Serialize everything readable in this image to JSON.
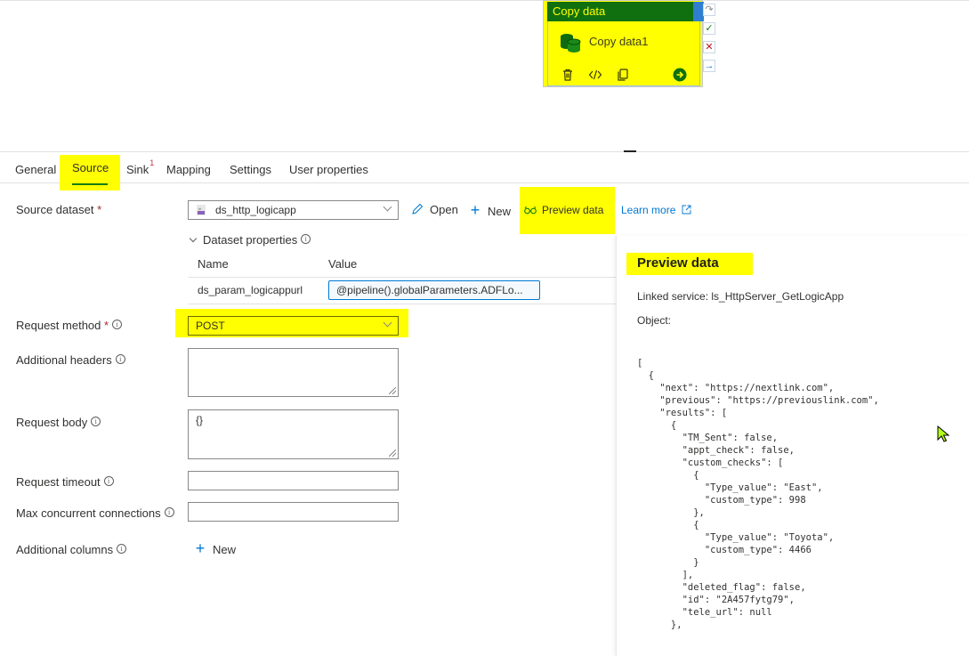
{
  "canvas": {
    "activity": {
      "type_label": "Copy data",
      "name": "Copy data1",
      "tools": [
        "delete-icon",
        "code-icon",
        "clone-icon",
        "go-icon"
      ],
      "side_actions": [
        "redo-icon",
        "success-icon",
        "failure-icon",
        "completion-icon"
      ]
    }
  },
  "tabs": [
    {
      "label": "General",
      "active": false
    },
    {
      "label": "Source",
      "active": true
    },
    {
      "label": "Sink",
      "badge": "1",
      "active": false
    },
    {
      "label": "Mapping",
      "active": false
    },
    {
      "label": "Settings",
      "active": false
    },
    {
      "label": "User properties",
      "active": false
    }
  ],
  "source": {
    "dataset_label": "Source dataset",
    "required_mark": "*",
    "dataset_value": "ds_http_logicapp",
    "actions": {
      "open": "Open",
      "new": "New",
      "preview": "Preview data",
      "learn_more": "Learn more"
    },
    "dataset_properties": {
      "label": "Dataset properties",
      "col_name": "Name",
      "col_value": "Value",
      "rows": [
        {
          "name": "ds_param_logicappurl",
          "value": "@pipeline().globalParameters.ADFLo..."
        }
      ]
    },
    "request_method": {
      "label": "Request method",
      "value": "POST"
    },
    "additional_headers": {
      "label": "Additional headers",
      "value": ""
    },
    "request_body": {
      "label": "Request body",
      "value": "{}"
    },
    "request_timeout": {
      "label": "Request timeout",
      "value": ""
    },
    "max_connections": {
      "label": "Max concurrent connections",
      "value": ""
    },
    "additional_columns": {
      "label": "Additional columns",
      "new_label": "New"
    }
  },
  "preview": {
    "title": "Preview data",
    "linked_service_label": "Linked service:",
    "linked_service_value": "ls_HttpServer_GetLogicApp",
    "object_label": "Object:",
    "json_text": "[\n  {\n    \"next\": \"https://nextlink.com\",\n    \"previous\": \"https://previouslink.com\",\n    \"results\": [\n      {\n        \"TM_Sent\": false,\n        \"appt_check\": false,\n        \"custom_checks\": [\n          {\n            \"Type_value\": \"East\",\n            \"custom_type\": 998\n          },\n          {\n            \"Type_value\": \"Toyota\",\n            \"custom_type\": 4466\n          }\n        ],\n        \"deleted_flag\": false,\n        \"id\": \"2A457fytg79\",\n        \"tele_url\": null\n      },"
  },
  "colors": {
    "highlight": "#ffff00",
    "activity_header": "#107010",
    "accent": "#0078d4",
    "tab_underline": "#107c10"
  }
}
